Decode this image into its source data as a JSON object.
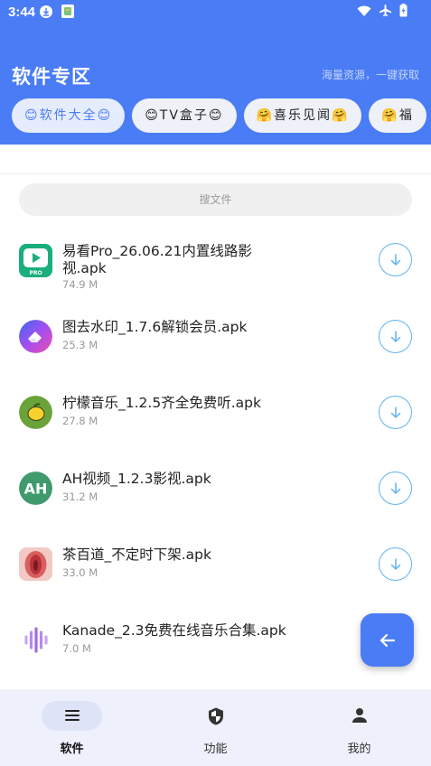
{
  "status_bar": {
    "time": "3:44"
  },
  "header": {
    "title": "软件专区",
    "subtitle": "海量资源，一键获取",
    "chips": [
      {
        "label": "😊软件大全😊",
        "active": true
      },
      {
        "label": "😊TV盒子😊",
        "active": false
      },
      {
        "label": "🤗喜乐见闻🤗",
        "active": false
      },
      {
        "label": "🤗福",
        "active": false
      }
    ]
  },
  "search": {
    "placeholder": "搜文件"
  },
  "files": [
    {
      "name": "易看Pro_26.06.21内置线路影视.apk",
      "size": "74.9 M",
      "icon": "yikan-pro-icon"
    },
    {
      "name": "图去水印_1.7.6解锁会员.apk",
      "size": "25.3 M",
      "icon": "watermark-eraser-icon"
    },
    {
      "name": "柠檬音乐_1.2.5齐全免费听.apk",
      "size": "27.8 M",
      "icon": "lemon-icon"
    },
    {
      "name": "AH视频_1.2.3影视.apk",
      "size": "31.2 M",
      "icon": "ah-video-icon"
    },
    {
      "name": "茶百道_不定时下架.apk",
      "size": "33.0 M",
      "icon": "chabaidao-icon"
    },
    {
      "name": "Kanade_2.3免费在线音乐合集.apk",
      "size": "7.0 M",
      "icon": "waveform-icon"
    }
  ],
  "bottom_nav": [
    {
      "label": "软件",
      "icon": "menu-icon",
      "active": true
    },
    {
      "label": "功能",
      "icon": "shield-icon",
      "active": false
    },
    {
      "label": "我的",
      "icon": "person-icon",
      "active": false
    }
  ],
  "colors": {
    "primary": "#4a7cf6",
    "download_ring": "#5fb3f0",
    "nav_bg": "#eef0fb"
  }
}
